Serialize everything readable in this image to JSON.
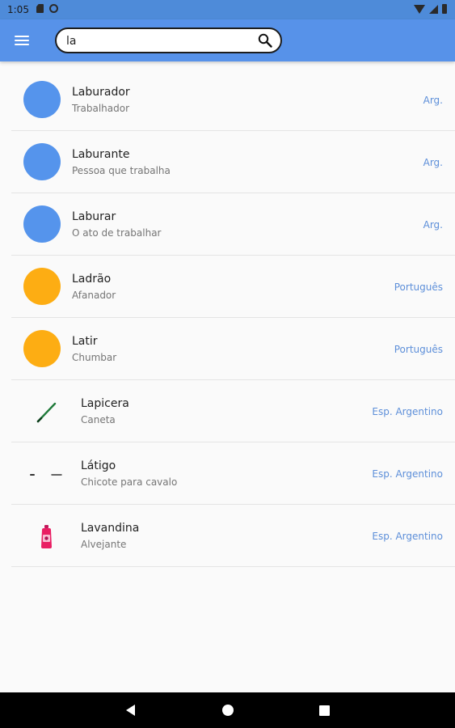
{
  "status_bar": {
    "time": "1:05"
  },
  "search": {
    "value": "la"
  },
  "items": [
    {
      "title": "Laburador",
      "subtitle": "Trabalhador",
      "lang": "Arg.",
      "thumb": "blue-circle",
      "color": "#5594ec"
    },
    {
      "title": "Laburante",
      "subtitle": "Pessoa que trabalha",
      "lang": "Arg.",
      "thumb": "blue-circle",
      "color": "#5594ec"
    },
    {
      "title": "Laburar",
      "subtitle": "O ato de trabalhar",
      "lang": "Arg.",
      "thumb": "blue-circle",
      "color": "#5594ec"
    },
    {
      "title": "Ladrão",
      "subtitle": "Afanador",
      "lang": "Português",
      "thumb": "orange-circle",
      "color": "#fdad13"
    },
    {
      "title": "Latir",
      "subtitle": "Chumbar",
      "lang": "Português",
      "thumb": "orange-circle",
      "color": "#fdad13"
    },
    {
      "title": "Lapicera",
      "subtitle": "Caneta",
      "lang": "Esp. Argentino",
      "thumb": "pen-image"
    },
    {
      "title": "Látigo",
      "subtitle": "Chicote para cavalo",
      "lang": "Esp. Argentino",
      "thumb": "whip-image"
    },
    {
      "title": "Lavandina",
      "subtitle": "Alvejante",
      "lang": "Esp. Argentino",
      "thumb": "bleach-bottle-image"
    }
  ],
  "colors": {
    "app_bar": "#5792e9",
    "accent_text": "#5d8fd9"
  }
}
